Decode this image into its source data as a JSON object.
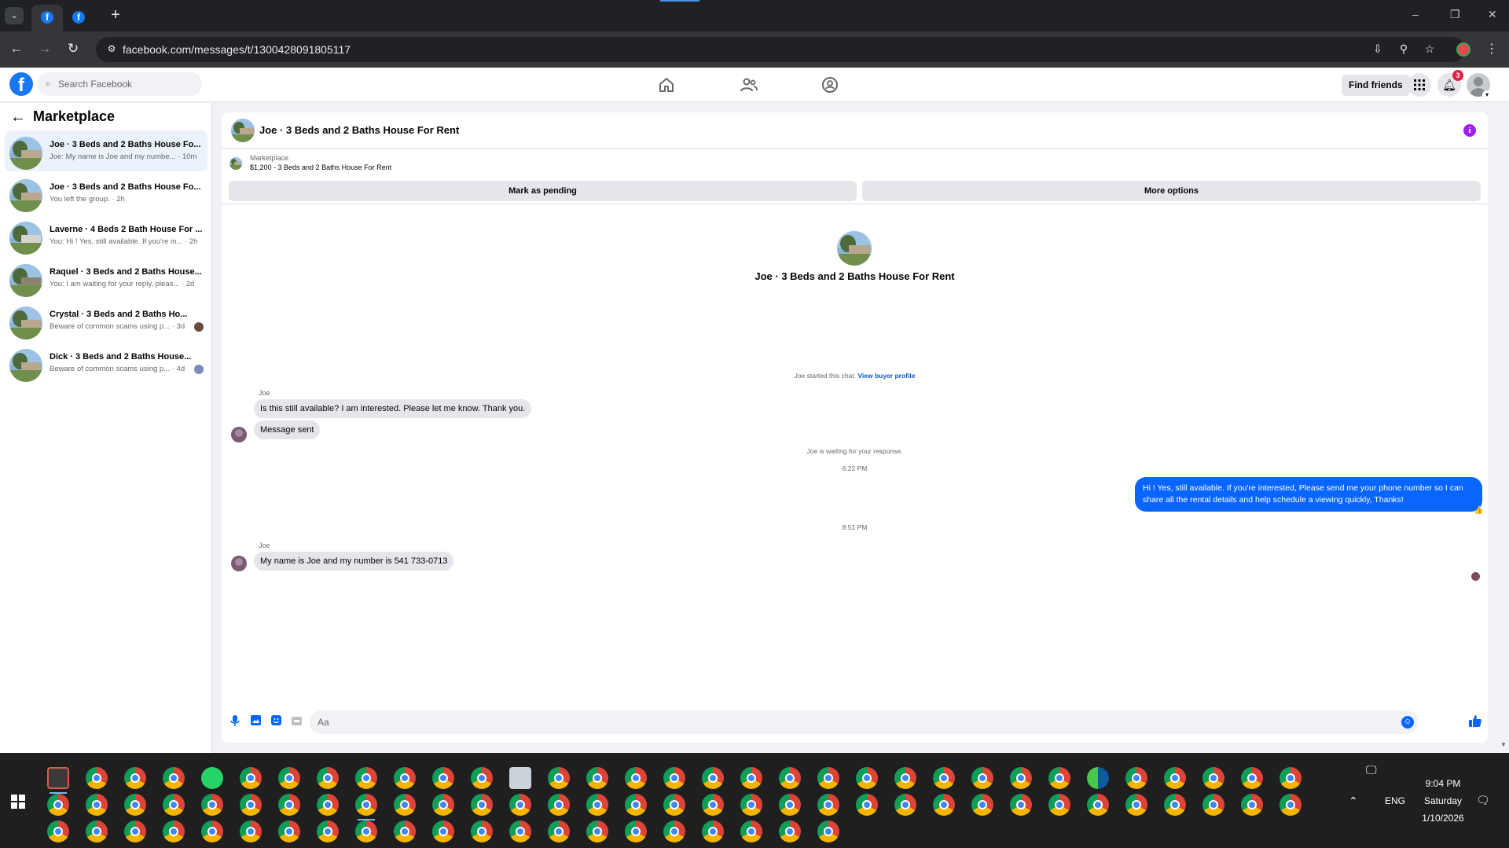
{
  "browser": {
    "url": "facebook.com/messages/t/1300428091805117",
    "new_tab_symbol": "+",
    "controls": {
      "back": "←",
      "forward": "→",
      "reload": "↻"
    },
    "window_controls": {
      "minimize": "–",
      "restore": "❐",
      "close": "✕"
    }
  },
  "header": {
    "logo": "f",
    "search_placeholder": "Search Facebook",
    "find_friends_label": "Find friends",
    "notification_count": "3"
  },
  "sidebar": {
    "title": "Marketplace",
    "conversations": [
      {
        "title": "Joe · 3 Beds and 2 Baths House Fo...",
        "subtitle": "Joe: My name is Joe and my numbe... · 10m",
        "active": true
      },
      {
        "title": "Joe · 3 Beds and 2 Baths House Fo...",
        "subtitle": "You left the group. · 2h"
      },
      {
        "title": "Laverne · 4 Beds 2 Bath House For ...",
        "subtitle": "You: Hi ! Yes, still available. If you're in... · 2h"
      },
      {
        "title": "Raquel · 3 Beds and 2 Baths House...",
        "subtitle": "You: I am waiting for your reply, pleas... · 2d"
      },
      {
        "title": "Crystal · 3 Beds and 2 Baths Ho...",
        "subtitle": "Beware of common scams using p... · 3d"
      },
      {
        "title": "Dick · 3 Beds and 2 Baths House...",
        "subtitle": "Beware of common scams using p... · 4d"
      }
    ]
  },
  "chat": {
    "title": "Joe · 3 Beds and 2 Baths House For Rent",
    "listing": {
      "label": "Marketplace",
      "price_title": "$1,200 - 3 Beds and 2 Baths House For Rent",
      "mark_pending_label": "Mark as pending",
      "more_options_label": "More options"
    },
    "intro_title": "Joe · 3 Beds and 2 Baths House For Rent",
    "started_text": "Joe started this chat.",
    "view_profile_link": "View buyer profile",
    "messages": {
      "sender_1": "Joe",
      "msg_1": "Is this still available?  I am interested.  Please let me know.  Thank you.",
      "msg_2": "Message sent",
      "waiting_text": "Joe is waiting for your response.",
      "time_1": "6:22 PM",
      "out_1": "Hi ! Yes, still available. If you're interested, Please send me your phone number so I can share all the rental details and help schedule a viewing quickly, Thanks!",
      "time_2": "8:51 PM",
      "sender_2": "Joe",
      "msg_3": "My name is Joe and my number is  541 733-0713"
    },
    "composer_placeholder": "Aa"
  },
  "taskbar": {
    "time": "9:04 PM",
    "day": "Saturday",
    "date": "1/10/2026",
    "language": "ENG"
  },
  "colors": {
    "facebook_blue": "#1877f2",
    "messenger_blue": "#0866ff",
    "info_purple": "#a020f0",
    "notification_red": "#e41e3f"
  }
}
